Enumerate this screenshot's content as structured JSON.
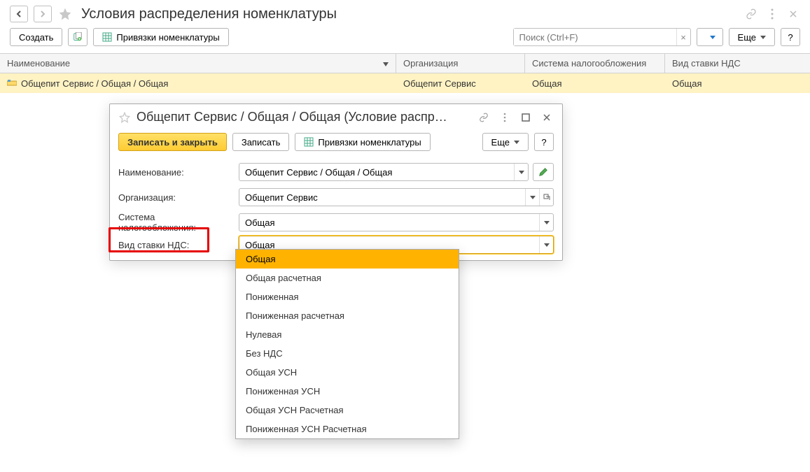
{
  "header": {
    "title": "Условия распределения номенклатуры"
  },
  "toolbar": {
    "create": "Создать",
    "bindings": "Привязки номенклатуры",
    "more": "Еще",
    "search_placeholder": "Поиск (Ctrl+F)"
  },
  "table": {
    "columns": {
      "name": "Наименование",
      "org": "Организация",
      "tax": "Система налогообложения",
      "vat": "Вид ставки НДС"
    },
    "rows": [
      {
        "name": "Общепит Сервис / Общая / Общая",
        "org": "Общепит Сервис",
        "tax": "Общая",
        "vat": "Общая"
      }
    ]
  },
  "dialog": {
    "title": "Общепит Сервис / Общая / Общая (Условие распр…",
    "save_close": "Записать и закрыть",
    "save": "Записать",
    "bindings": "Привязки номенклатуры",
    "more": "Еще",
    "labels": {
      "name": "Наименование:",
      "org": "Организация:",
      "tax": "Система налогообложения:",
      "vat": "Вид ставки НДС:"
    },
    "values": {
      "name": "Общепит Сервис / Общая / Общая",
      "org": "Общепит Сервис",
      "tax": "Общая",
      "vat": "Общая"
    }
  },
  "dropdown": {
    "options": [
      "Общая",
      "Общая расчетная",
      "Пониженная",
      "Пониженная расчетная",
      "Нулевая",
      "Без НДС",
      "Общая УСН",
      "Пониженная УСН",
      "Общая УСН Расчетная",
      "Пониженная УСН Расчетная"
    ],
    "selected_index": 0
  }
}
